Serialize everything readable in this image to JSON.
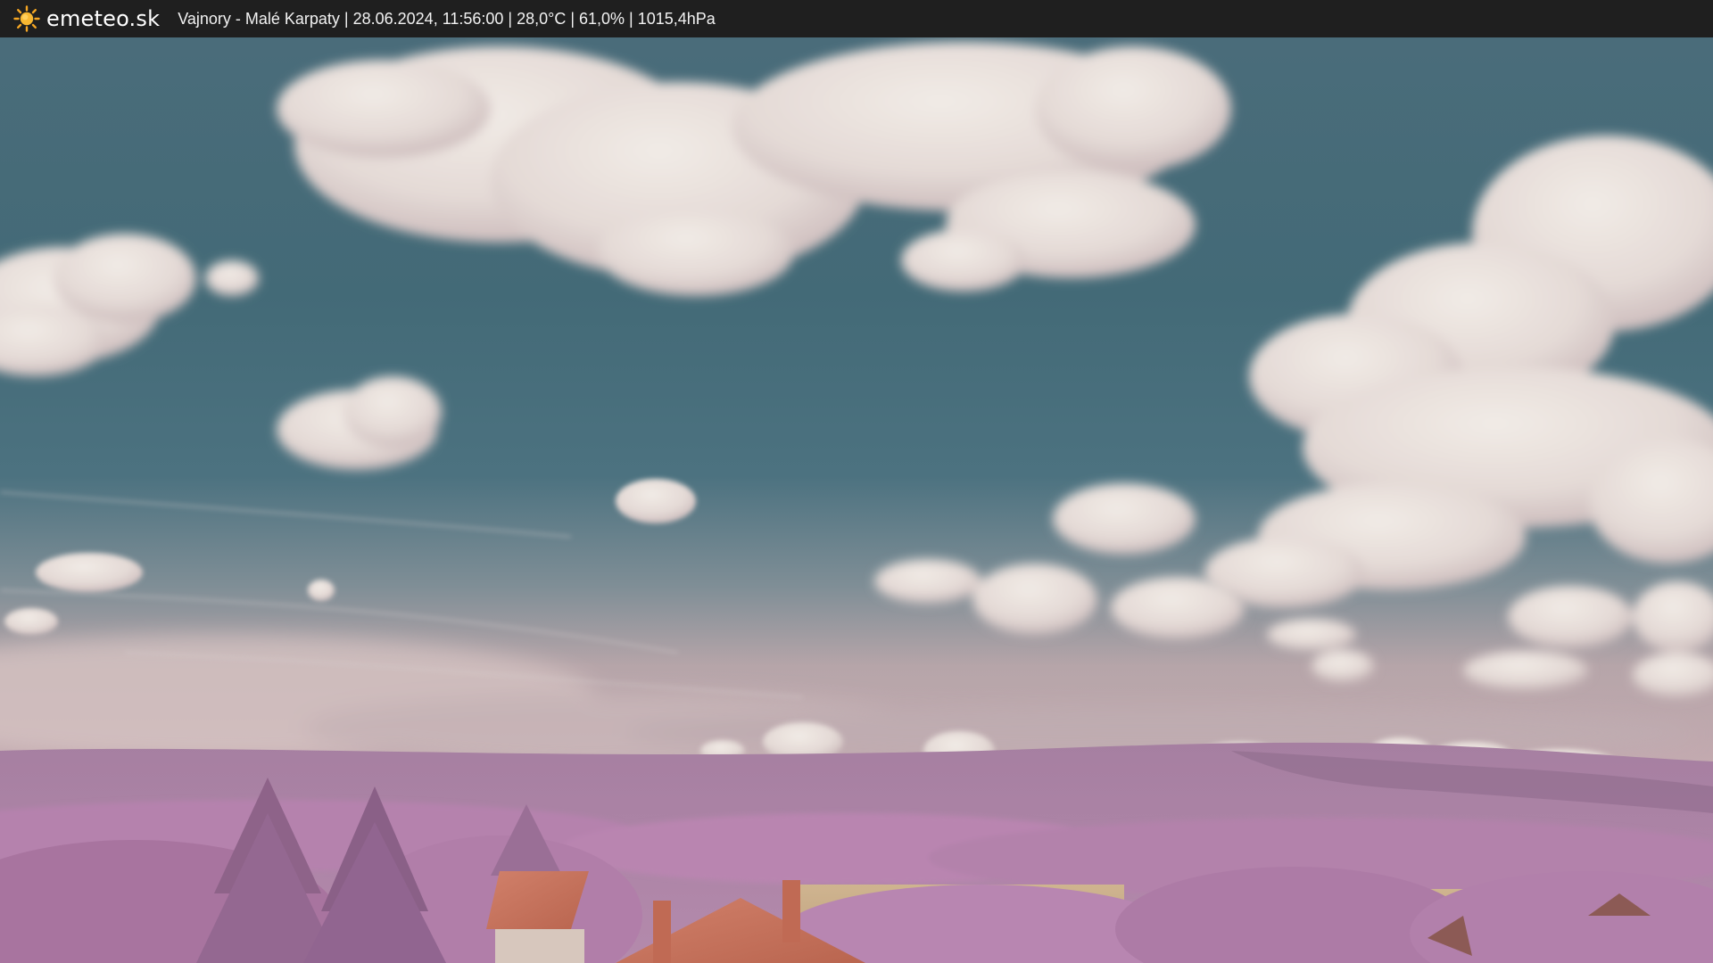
{
  "header": {
    "brand": "emeteo.sk",
    "caption": "Vajnory - Malé Karpaty | 28.06.2024, 11:56:00 | 28,0°C | 61,0% | 1015,4hPa",
    "logo_icon": "sun-icon",
    "background": "#1f1f1f"
  },
  "webcam": {
    "colors": {
      "sky_top": "#4a6c7a",
      "sky_mid": "#3f6a78",
      "sky_horizon": "#b9a6a9",
      "hills": "#a77e9f",
      "vegetation": "#b17eab",
      "fields": "#c7ab86",
      "roofs": "#c8715a",
      "clouds": "#e8e1dc"
    }
  }
}
